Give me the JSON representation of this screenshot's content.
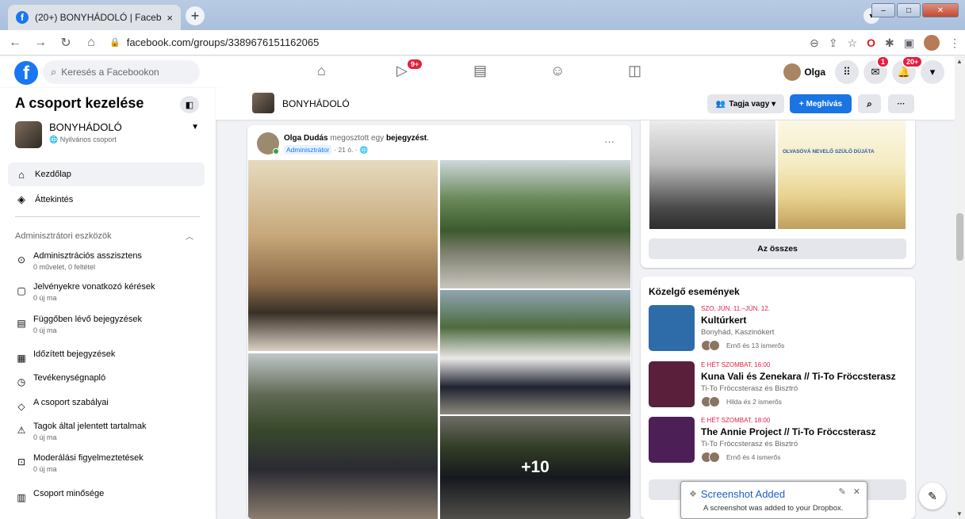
{
  "browser": {
    "tab_title": "(20+) BONYHÁDOLÓ | Facebook",
    "tab_close": "×",
    "new_tab": "+",
    "url": "facebook.com/groups/3389676151162065",
    "win_min": "–",
    "win_max": "□",
    "win_close": "✕"
  },
  "fb_header": {
    "search_placeholder": "Keresés a Facebookon",
    "user_name": "Olga",
    "video_badge": "9+",
    "messenger_badge": "1",
    "notif_badge": "20+"
  },
  "sidebar": {
    "title": "A csoport kezelése",
    "group_name": "BONYHÁDOLÓ",
    "group_privacy": "Nyilvános csoport",
    "nav": [
      {
        "label": "Kezdőlap"
      },
      {
        "label": "Áttekintés"
      }
    ],
    "admin_section": "Adminisztrátori eszközök",
    "tools": [
      {
        "label": "Adminisztrációs asszisztens",
        "sub": "0 művelet, 0 feltétel"
      },
      {
        "label": "Jelvényekre vonatkozó kérések",
        "sub": "0 új ma"
      },
      {
        "label": "Függőben lévő bejegyzések",
        "sub": "0 új ma"
      },
      {
        "label": "Időzített bejegyzések",
        "sub": ""
      },
      {
        "label": "Tevékenységnapló",
        "sub": ""
      },
      {
        "label": "A csoport szabályai",
        "sub": ""
      },
      {
        "label": "Tagok által jelentett tartalmak",
        "sub": "0 új ma"
      },
      {
        "label": "Moderálási figyelmeztetések",
        "sub": "0 új ma"
      },
      {
        "label": "Csoport minősége",
        "sub": ""
      }
    ]
  },
  "groupbar": {
    "name": "BONYHÁDOLÓ",
    "member_btn": "Tagja vagy ▾",
    "invite_btn": "+ Meghívás",
    "more_btn": "···"
  },
  "post": {
    "author": "Olga Dudás",
    "action_text": "megosztott egy",
    "action_link": "bejegyzést",
    "role": "Adminisztrátor",
    "time": "· 21 ó. ·",
    "more": "···",
    "more_photos": "+10"
  },
  "right": {
    "media_text": "OLVASÓVÁ NEVELŐ SZÜLŐ DÜJÁTA",
    "all_button": "Az összes",
    "events_heading": "Közelgő események",
    "events": [
      {
        "date": "SZO, JÚN. 11.–JÚN. 12.",
        "name": "Kultúrkert",
        "location": "Bonyhád, Kaszinókert",
        "friends": "Ernő és 13 ismerős",
        "color": "#2d6ca8"
      },
      {
        "date": "E HÉT SZOMBAT, 16:00",
        "name": "Kuna Vali és Zenekara // Ti-To Fröccsterasz",
        "location": "Ti-To Fröccsterasz és Bisztró",
        "friends": "Hilda és 2 ismerős",
        "color": "#5a1f3a"
      },
      {
        "date": "E HÉT SZOMBAT, 18:00",
        "name": "The Annie Project // Ti-To Fröccsterasz",
        "location": "Ti-To Fröccsterasz és Bisztró",
        "friends": "Ernő és 4 ismerős",
        "color": "#4d1f57"
      }
    ]
  },
  "toast": {
    "title": "Screenshot Added",
    "body": "A screenshot was added to your Dropbox."
  }
}
